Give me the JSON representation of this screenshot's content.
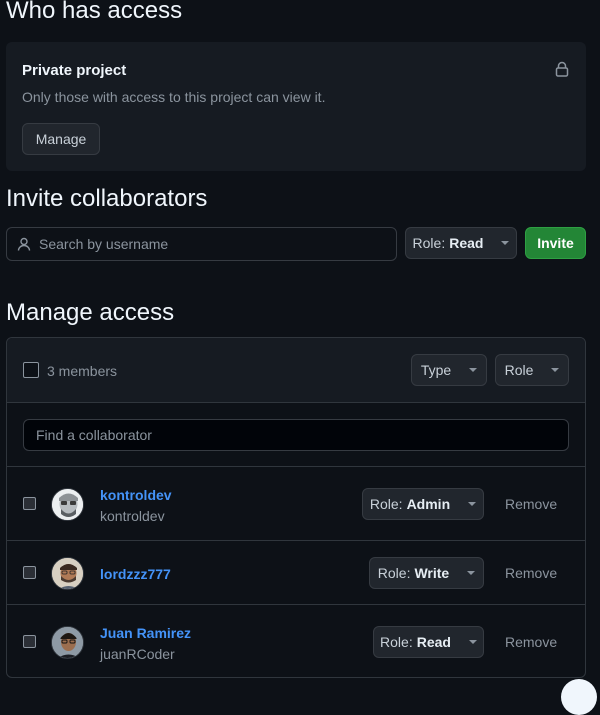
{
  "who_has_access": {
    "heading": "Who has access",
    "visibility_title": "Private project",
    "visibility_desc": "Only those with access to this project can view it.",
    "manage_label": "Manage",
    "lock_icon": "lock-icon"
  },
  "invite": {
    "heading": "Invite collaborators",
    "search_placeholder": "Search by username",
    "role_prefix": "Role:",
    "role_value": "Read",
    "invite_label": "Invite",
    "invite_color": "#238636"
  },
  "manage_access": {
    "heading": "Manage access",
    "members_count": "3 members",
    "type_filter": "Type",
    "role_filter": "Role",
    "find_placeholder": "Find a collaborator",
    "role_prefix": "Role:",
    "remove_label": "Remove",
    "members": [
      {
        "name": "kontroldev",
        "handle": "kontroldev",
        "role": "Admin"
      },
      {
        "name": "lordzzz777",
        "handle": "",
        "role": "Write"
      },
      {
        "name": "Juan Ramirez",
        "handle": "juanRCoder",
        "role": "Read"
      }
    ]
  }
}
